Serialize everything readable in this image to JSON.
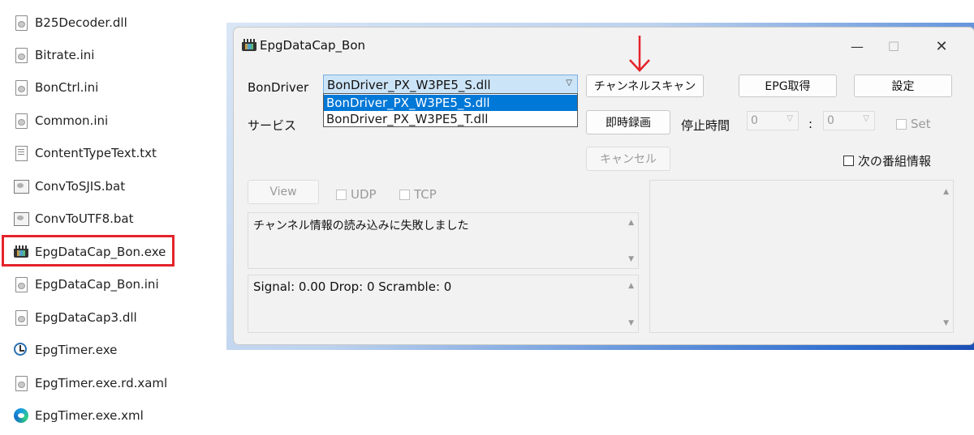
{
  "files": [
    {
      "name": "B25Decoder.dll",
      "icon": "dll-file-icon"
    },
    {
      "name": "Bitrate.ini",
      "icon": "ini-file-icon"
    },
    {
      "name": "BonCtrl.ini",
      "icon": "ini-file-icon"
    },
    {
      "name": "Common.ini",
      "icon": "ini-file-icon"
    },
    {
      "name": "ContentTypeText.txt",
      "icon": "text-file-icon"
    },
    {
      "name": "ConvToSJIS.bat",
      "icon": "batch-file-icon"
    },
    {
      "name": "ConvToUTF8.bat",
      "icon": "batch-file-icon"
    },
    {
      "name": "EpgDataCap_Bon.exe",
      "icon": "epgdatacap-app-icon"
    },
    {
      "name": "EpgDataCap_Bon.ini",
      "icon": "ini-file-icon"
    },
    {
      "name": "EpgDataCap3.dll",
      "icon": "dll-file-icon"
    },
    {
      "name": "EpgTimer.exe",
      "icon": "clock-icon"
    },
    {
      "name": "EpgTimer.exe.rd.xaml",
      "icon": "xaml-file-icon"
    },
    {
      "name": "EpgTimer.exe.xml",
      "icon": "edge-icon"
    }
  ],
  "window": {
    "title": "EpgDataCap_Bon",
    "minimize": "—",
    "maximize": "☐",
    "close": "✕"
  },
  "bondriver": {
    "label": "BonDriver",
    "selected": "BonDriver_PX_W3PE5_S.dll",
    "options": [
      "BonDriver_PX_W3PE5_S.dll",
      "BonDriver_PX_W3PE5_T.dll"
    ]
  },
  "service": {
    "label": "サービス"
  },
  "buttons": {
    "channel_scan": "チャンネルスキャン",
    "epg_get": "EPG取得",
    "settings": "設定",
    "instant_record": "即時録画",
    "cancel": "キャンセル",
    "view": "View"
  },
  "stop_time": {
    "label": "停止時間",
    "hour": "0",
    "minute": "0",
    "separator": ":",
    "set_label": "Set"
  },
  "next_program": {
    "label": "次の番組情報"
  },
  "network": {
    "udp": "UDP",
    "tcp": "TCP"
  },
  "log": {
    "message": "チャンネル情報の読み込みに失敗しました"
  },
  "status": {
    "text": "Signal: 0.00 Drop: 0 Scramble: 0"
  },
  "colors": {
    "highlight_border": "#e4232b",
    "arrow": "#e4232b",
    "dropdown_selected": "#0078d7",
    "combo_background": "#cce4f7"
  }
}
